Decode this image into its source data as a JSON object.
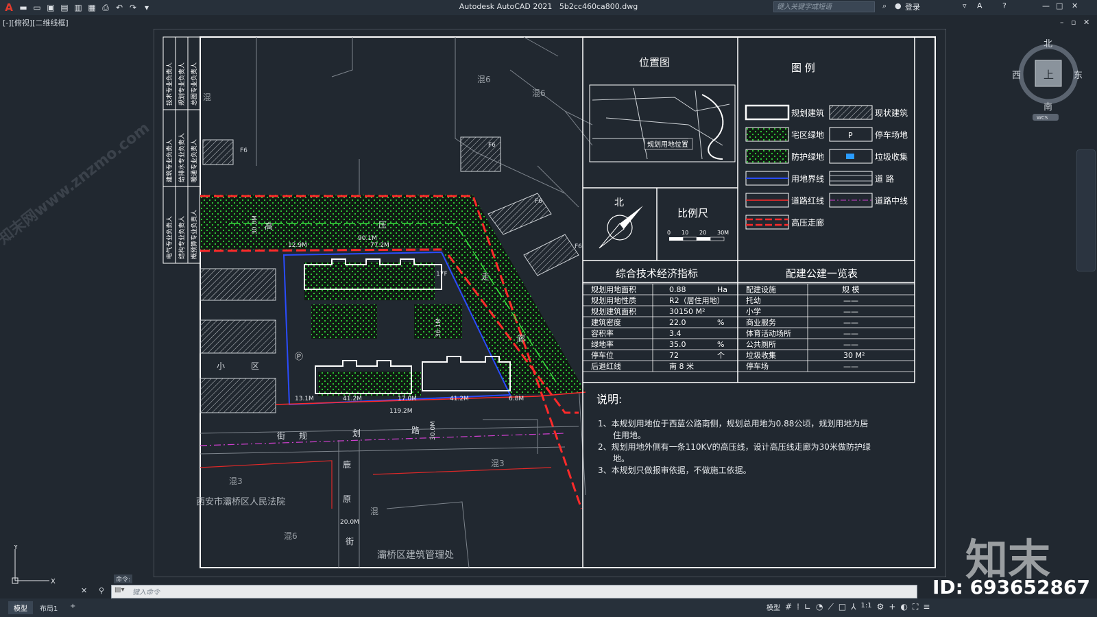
{
  "app": {
    "title": "Autodesk AutoCAD 2021",
    "file": "5b2cc460ca800.dwg",
    "search_placeholder": "键入关键字或短语",
    "login": "登录",
    "view_label": "[-][俯视][二维线框]"
  },
  "nav": {
    "north": "北",
    "south": "南",
    "east": "东",
    "west": "西",
    "cube_face": "上",
    "wcs": "WCS"
  },
  "command": {
    "label": "命令:",
    "placeholder": "键入命令"
  },
  "layout_tabs": [
    "模型",
    "布局1",
    "+"
  ],
  "status": {
    "model": "模型",
    "scale": "1:1"
  },
  "watermark": {
    "brand": "知末",
    "id": "ID: 693652867",
    "site": "知末网www.znzmo.com"
  },
  "drawing": {
    "location_title": "位置图",
    "location_label": "规划用地位置",
    "legend_title": "图 例",
    "legend": [
      {
        "label": "规划建筑"
      },
      {
        "label": "现状建筑"
      },
      {
        "label": "宅区绿地"
      },
      {
        "label": "停车场地"
      },
      {
        "label": "防护绿地"
      },
      {
        "label": "垃圾收集"
      },
      {
        "label": "用地界线"
      },
      {
        "label": "道 路"
      },
      {
        "label": "道路红线"
      },
      {
        "label": "道路中线"
      },
      {
        "label": "高压走廊"
      }
    ],
    "north_label": "北",
    "scale_title": "比例尺",
    "scale_ticks": [
      "0",
      "10",
      "20",
      "30M"
    ],
    "eco_title": "综合技术经济指标",
    "eco_rows": [
      {
        "name": "规划用地面积",
        "value": "0.88",
        "unit": "Ha"
      },
      {
        "name": "规划用地性质",
        "value": "R2（居住用地）",
        "unit": ""
      },
      {
        "name": "规划建筑面积",
        "value": "30150 M²",
        "unit": ""
      },
      {
        "name": "建筑密度",
        "value": "22.0",
        "unit": "%"
      },
      {
        "name": "容积率",
        "value": "3.4",
        "unit": ""
      },
      {
        "name": "绿地率",
        "value": "35.0",
        "unit": "%"
      },
      {
        "name": "停车位",
        "value": "72",
        "unit": "个"
      },
      {
        "name": "后退红线",
        "value": "南 8 米",
        "unit": ""
      }
    ],
    "pub_title": "配建公建一览表",
    "pub_head": [
      "配建设施",
      "规 模"
    ],
    "pub_rows": [
      {
        "name": "托幼",
        "value": "——"
      },
      {
        "name": "小学",
        "value": "——"
      },
      {
        "name": "商业服务",
        "value": "——"
      },
      {
        "name": "体育活动场所",
        "value": "——"
      },
      {
        "name": "公共厕所",
        "value": "——"
      },
      {
        "name": "垃圾收集",
        "value": "30 M²"
      },
      {
        "name": "停车场",
        "value": "——"
      }
    ],
    "notes_title": "说明:",
    "notes": [
      "1、本规划用地位于西蓝公路南侧，规划总用地为0.88公顷，规划用地为居",
      "住用地。",
      "2、规划用地外侧有一条110KV的高压线，设计高压线走廊为30米做防护绿",
      "地。",
      "3、本规划只做报审依据，不做施工依据。"
    ],
    "left_strip": [
      "技术专业负责人",
      "规划专业负责人",
      "总图专业负责人",
      "建筑专业负责人",
      "给排水专业负责人",
      "暖通专业负责人",
      "电气专业负责人",
      "结构专业负责人",
      "概预算专业负责人"
    ],
    "map_labels": {
      "street1": "街",
      "street2": "规",
      "street3": "划",
      "street4": "路",
      "road_v1": "鹿",
      "road_v2": "原",
      "road_v3": "街",
      "hv1": "高",
      "hv2": "压",
      "hv3": "走",
      "hv4": "廊",
      "area1": "小",
      "area2": "区",
      "bldg_a": "西安市灞桥区人民法院",
      "bldg_b": "灞桥区建筑管理处",
      "hun": "混",
      "hun3": "混3",
      "hun6": "混6",
      "f6": "F6",
      "f17": "17F",
      "d1": "90.1M",
      "d2": "77.2M",
      "d3": "12.9M",
      "d4": "41.2M",
      "d5": "17.0M",
      "d6": "41.2M",
      "d7": "13.1M",
      "d8": "6.8M",
      "d9": "119.2M",
      "d10": "30.0M",
      "d11": "20.0M",
      "d12": "36.1M",
      "d13": "30.0M"
    }
  }
}
